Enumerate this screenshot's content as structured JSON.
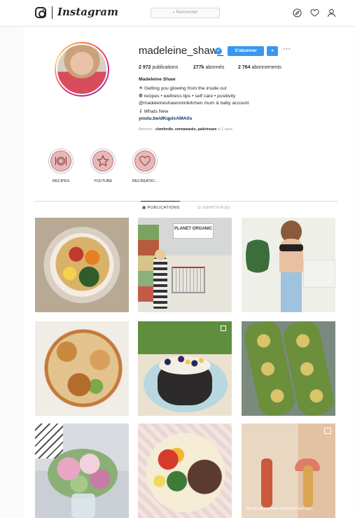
{
  "header": {
    "brand": "Instagram",
    "search_placeholder": "Rechercher",
    "icons": [
      "instagram-glyph-icon",
      "compass-icon",
      "heart-icon",
      "profile-icon"
    ]
  },
  "profile": {
    "username": "madeleine_shaw_",
    "verified": true,
    "follow_label": "S'abonner",
    "dropdown_label": "▾",
    "more_label": "···",
    "stats": {
      "publications_count": "2 972",
      "publications_label": "publications",
      "followers_count": "277k",
      "followers_label": "abonnés",
      "following_count": "2 764",
      "following_label": "abonnements"
    },
    "full_name": "Madeleine Shaw",
    "bio_lines": [
      "☀ Getting you glowing from the inside out",
      "❁ recipes • wellness tips • self care • positivity",
      "@madeleineshawsminikitchen mum & baby account",
      "⇓ Whats New"
    ],
    "link": "youtu.be/dKqplxAMA0s",
    "followed_by_prefix": "Abonnés :",
    "followed_by_names": "clemfordie, emmawasko, pakirinoare",
    "followed_by_suffix": "et 1 autre"
  },
  "highlights": [
    {
      "label": "RECIPES",
      "icon": "plate-cutlery-icon"
    },
    {
      "label": "YOUTUBE",
      "icon": "star-icon"
    },
    {
      "label": "RECREATIO...",
      "icon": "heart-icon"
    }
  ],
  "tabs": [
    {
      "label": "PUBLICATIONS",
      "icon": "grid-icon",
      "active": true
    },
    {
      "label": "IDENTIFIÉ(E)",
      "icon": "tag-icon",
      "active": false
    }
  ],
  "posts": [
    {
      "subject": "pasta-salad"
    },
    {
      "subject": "planet-organic-store",
      "sign": "PLANET ORGANIC"
    },
    {
      "subject": "woman-in-jeans"
    },
    {
      "subject": "tofu-bowl"
    },
    {
      "subject": "pancakes",
      "multi": true
    },
    {
      "subject": "avocado-toast"
    },
    {
      "subject": "flowers"
    },
    {
      "subject": "fajita-plate"
    },
    {
      "subject": "video",
      "caption": "We virtually just been having the best chat.",
      "video": true
    }
  ]
}
